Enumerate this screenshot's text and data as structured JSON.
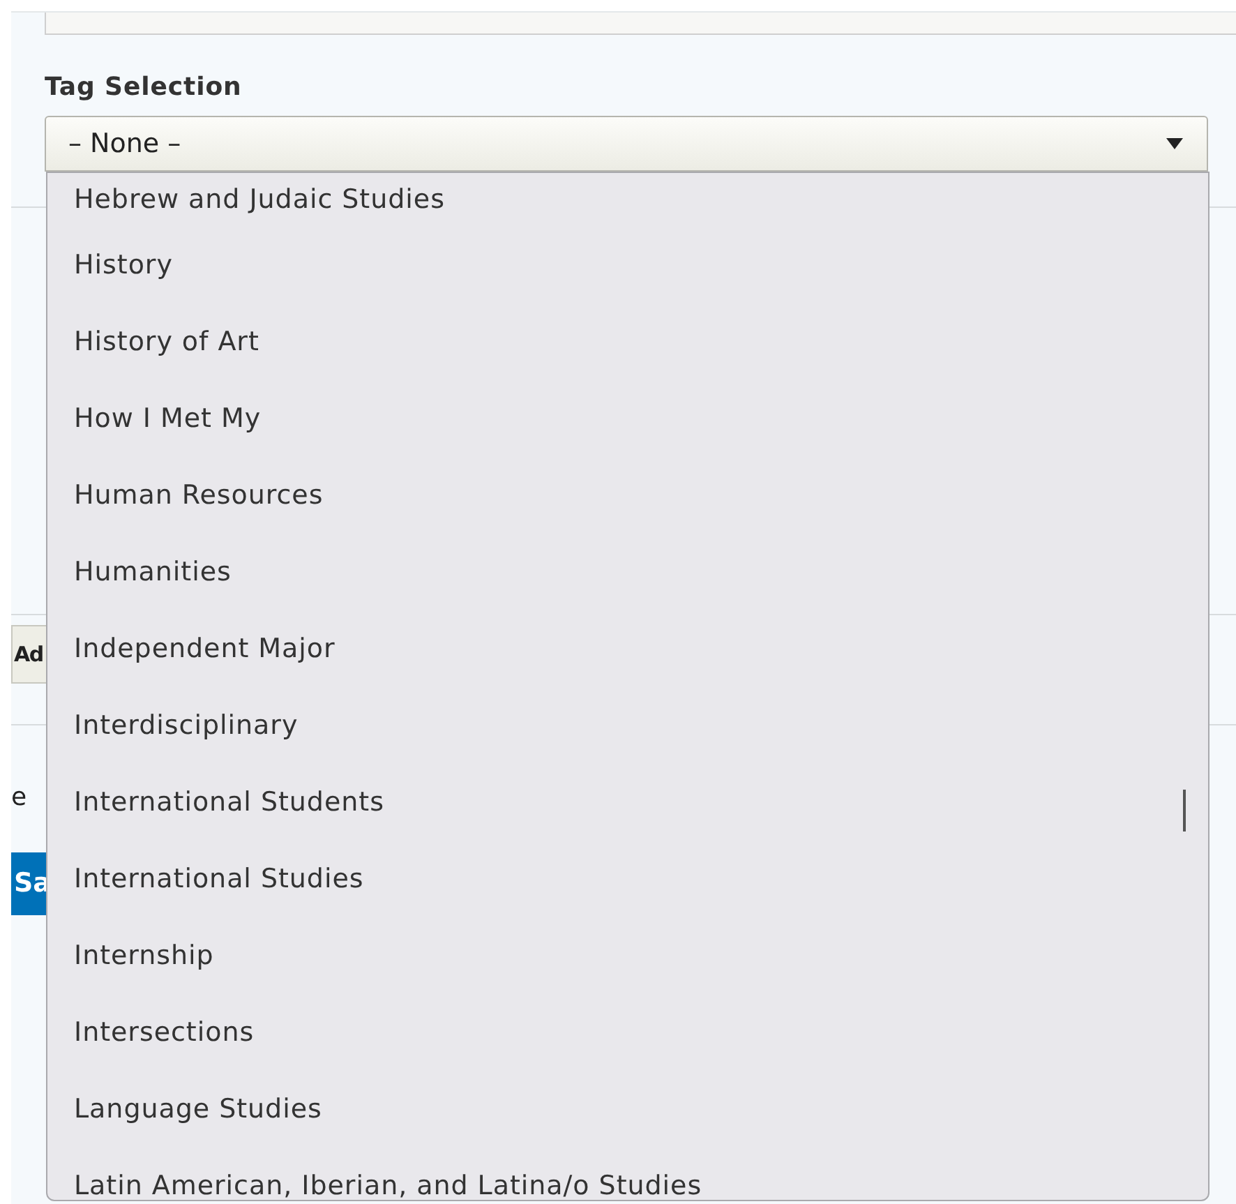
{
  "label": "Tag Selection",
  "select": {
    "value": "– None –",
    "expanded": true
  },
  "options": [
    {
      "label": "Hebrew and Judaic Studies"
    },
    {
      "label": "History"
    },
    {
      "label": "History of Art"
    },
    {
      "label": "How I Met My"
    },
    {
      "label": "Human Resources"
    },
    {
      "label": "Humanities"
    },
    {
      "label": "Independent Major"
    },
    {
      "label": "Interdisciplinary"
    },
    {
      "label": "International Students"
    },
    {
      "label": "International Studies"
    },
    {
      "label": "Internship"
    },
    {
      "label": "Intersections"
    },
    {
      "label": "Language Studies"
    },
    {
      "label": "Latin American, Iberian, and Latina/o Studies"
    }
  ],
  "behind": {
    "add_button": "Ad",
    "text": "e",
    "save_button": "Sa"
  }
}
